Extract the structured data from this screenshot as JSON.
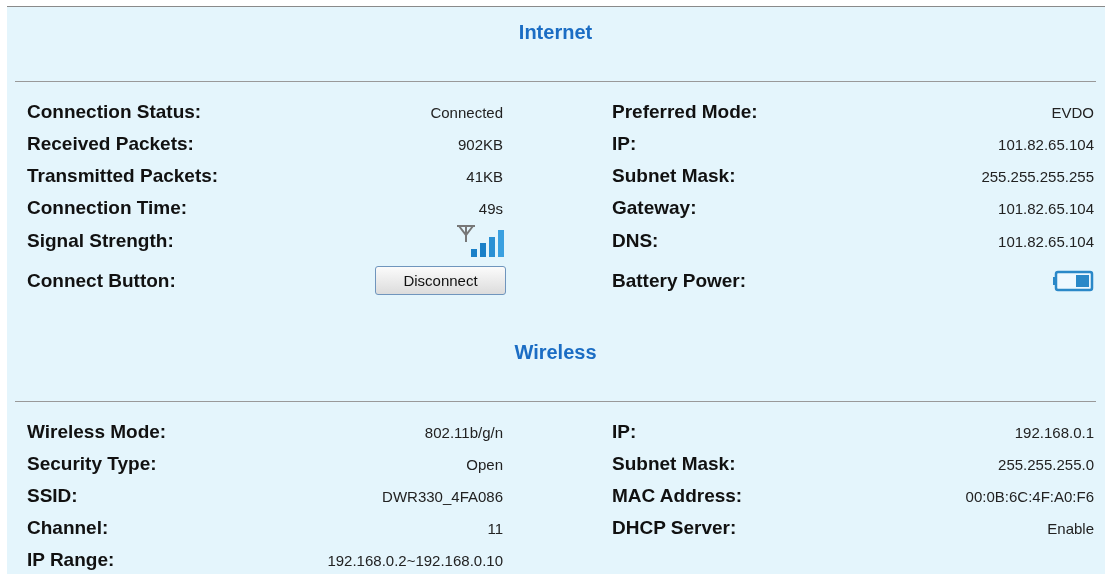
{
  "sections": [
    {
      "title": "Internet",
      "left": [
        {
          "label": "Connection Status:",
          "kind": "text",
          "value": "Connected"
        },
        {
          "label": "Received Packets:",
          "kind": "text",
          "value": "902KB"
        },
        {
          "label": "Transmitted Packets:",
          "kind": "text",
          "value": "41KB"
        },
        {
          "label": "Connection Time:",
          "kind": "text",
          "value": "49s"
        },
        {
          "label": "Signal Strength:",
          "kind": "signal"
        },
        {
          "label": "Connect Button:",
          "kind": "button",
          "value": "Disconnect"
        }
      ],
      "right": [
        {
          "label": "Preferred Mode:",
          "kind": "text",
          "value": "EVDO"
        },
        {
          "label": "IP:",
          "kind": "text",
          "value": "101.82.65.104"
        },
        {
          "label": "Subnet Mask:",
          "kind": "text",
          "value": "255.255.255.255"
        },
        {
          "label": "Gateway:",
          "kind": "text",
          "value": "101.82.65.104"
        },
        {
          "label": "DNS:",
          "kind": "text",
          "value": "101.82.65.104"
        },
        {
          "label": "Battery Power:",
          "kind": "battery"
        }
      ]
    },
    {
      "title": "Wireless",
      "left": [
        {
          "label": "Wireless Mode:",
          "kind": "text",
          "value": "802.11b/g/n"
        },
        {
          "label": "Security Type:",
          "kind": "text",
          "value": "Open"
        },
        {
          "label": "SSID:",
          "kind": "text",
          "value": "DWR330_4FA086"
        },
        {
          "label": "Channel:",
          "kind": "text",
          "value": "11"
        },
        {
          "label": "IP Range:",
          "kind": "text",
          "value": "192.168.0.2~192.168.0.10"
        }
      ],
      "right": [
        {
          "label": "IP:",
          "kind": "text",
          "value": "192.168.0.1"
        },
        {
          "label": "Subnet Mask:",
          "kind": "text",
          "value": "255.255.255.0"
        },
        {
          "label": "MAC Address:",
          "kind": "text",
          "value": "00:0B:6C:4F:A0:F6"
        },
        {
          "label": "DHCP Server:",
          "kind": "text",
          "value": "Enable"
        }
      ]
    }
  ]
}
